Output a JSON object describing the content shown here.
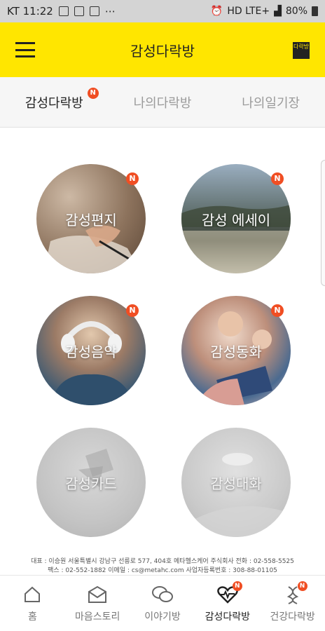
{
  "status_bar": {
    "carrier_time": "KT 11:22",
    "dots": "⋯",
    "network": "HD LTE+",
    "battery": "80%"
  },
  "app_bar": {
    "title": "감성다락방",
    "logo_text": "다락방"
  },
  "tabs": [
    {
      "label": "감성다락방",
      "badge": "N"
    },
    {
      "label": "나의다락방"
    },
    {
      "label": "나의일기장"
    }
  ],
  "grid": [
    {
      "label": "감성편지",
      "badge": "N"
    },
    {
      "label": "감성 에세이",
      "badge": "N"
    },
    {
      "label": "감성음악",
      "badge": "N"
    },
    {
      "label": "감성동화",
      "badge": "N"
    },
    {
      "label": "감성카드"
    },
    {
      "label": "감성대화"
    }
  ],
  "footer": {
    "line1": "대표 : 이승원 서울특별시 강남구 선릉로 577, 404호 메타헬스케어 주식회사 전화 : 02-558-5525",
    "line2": "팩스 : 02-552-1882 이메일 : cs@metahc.com 사업자등록번호 : 308-88-01105"
  },
  "bottom_nav": [
    {
      "label": "홈",
      "icon": "home-icon"
    },
    {
      "label": "마음스토리",
      "icon": "envelope-icon"
    },
    {
      "label": "이야기방",
      "icon": "chat-bubbles-icon"
    },
    {
      "label": "감성다락방",
      "icon": "heart-pulse-icon",
      "badge": "N"
    },
    {
      "label": "건강다락방",
      "icon": "dna-icon",
      "badge": "N"
    }
  ],
  "colors": {
    "accent": "#ffe600",
    "badge": "#f04e23"
  }
}
